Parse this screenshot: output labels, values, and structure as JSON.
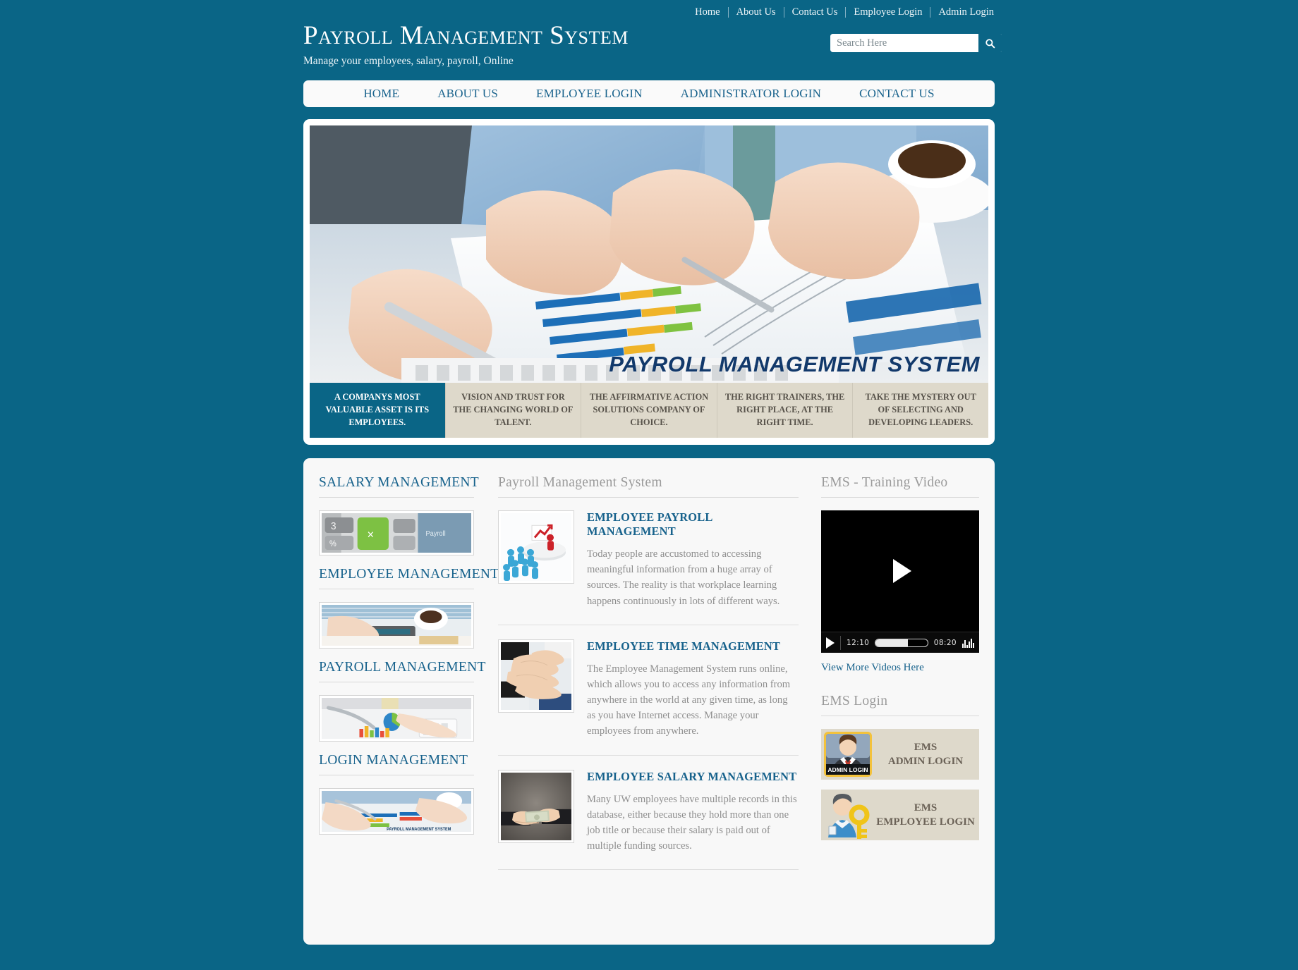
{
  "theme": {
    "bg": "#0a6586",
    "accent": "#17628c",
    "caption_bg": "#ded9cb",
    "panel_bg": "#f8f8f8"
  },
  "topnav": {
    "items": [
      {
        "label": "Home"
      },
      {
        "label": "About Us"
      },
      {
        "label": "Contact Us"
      },
      {
        "label": "Employee Login"
      },
      {
        "label": "Admin Login"
      }
    ]
  },
  "brand": {
    "title": "Payroll Management System",
    "tagline": "Manage your employees, salary, payroll, Online"
  },
  "search": {
    "placeholder": "Search Here",
    "value": "",
    "icon": "search-icon"
  },
  "mainnav": {
    "items": [
      {
        "label": "HOME"
      },
      {
        "label": "ABOUT US"
      },
      {
        "label": "EMPLOYEE LOGIN"
      },
      {
        "label": "ADMINISTRATOR LOGIN"
      },
      {
        "label": "CONTACT US"
      }
    ]
  },
  "banner": {
    "overlay_title": "PAYROLL MANAGEMENT SYSTEM",
    "captions": [
      {
        "text": "A Companys most valuable asset is its employees.",
        "active": true
      },
      {
        "text": "Vision and trust for the changing world of talent.",
        "active": false
      },
      {
        "text": "The affirmative action solutions company of choice.",
        "active": false
      },
      {
        "text": "The right trainers, the right place, at the right time.",
        "active": false
      },
      {
        "text": "Take the mystery out of selecting and developing leaders.",
        "active": false
      }
    ]
  },
  "sidebar_left": {
    "sections": [
      {
        "title": "SALARY MANAGEMENT",
        "image": "calculator-payroll-keys-thumb"
      },
      {
        "title": "EMPLOYEE MANAGEMENT",
        "image": "hand-on-calculator-coffee-thumb"
      },
      {
        "title": "PAYROLL MANAGEMENT",
        "image": "pen-chart-calculator-thumb"
      },
      {
        "title": "LOGIN MANAGEMENT",
        "image": "hands-charts-payroll-thumb"
      }
    ]
  },
  "main": {
    "title": "Payroll Management System",
    "articles": [
      {
        "title": "EMPLOYEE PAYROLL MANAGEMENT",
        "image": "blue-figures-red-leader-chart-icon",
        "text": "Today people are accustomed to accessing meaningful information from a huge array of sources. The reality is that workplace learning happens continuously in lots of different ways."
      },
      {
        "title": "EMPLOYEE TIME MANAGEMENT",
        "image": "team-hands-stacked-photo",
        "text": "The Employee Management System runs online, which allows you to access any information from anywhere in the world at any given time, as long as you have Internet access. Manage your employees from anywhere."
      },
      {
        "title": "EMPLOYEE SALARY MANAGEMENT",
        "image": "hands-exchanging-money-photo",
        "text": "Many UW employees have multiple records in this database, either because they hold more than one job title or because their salary is paid out of multiple funding sources."
      }
    ]
  },
  "sidebar_right": {
    "video_section_title": "EMS - Training Video",
    "video": {
      "current_time": "12:10",
      "remaining_time": "08:20",
      "progress_percent": 62,
      "play_icon": "play-icon",
      "volume_icon": "volume-icon"
    },
    "more_videos_link": "View More Videos Here",
    "login_section_title": "EMS Login",
    "login_boxes": [
      {
        "line1": "EMS",
        "line2": "ADMIN LOGIN",
        "avatar": "admin-avatar-icon",
        "badge": "ADMIN LOGIN"
      },
      {
        "line1": "EMS",
        "line2": "EMPLOYEE LOGIN",
        "avatar": "employee-key-avatar-icon",
        "badge": ""
      }
    ]
  }
}
